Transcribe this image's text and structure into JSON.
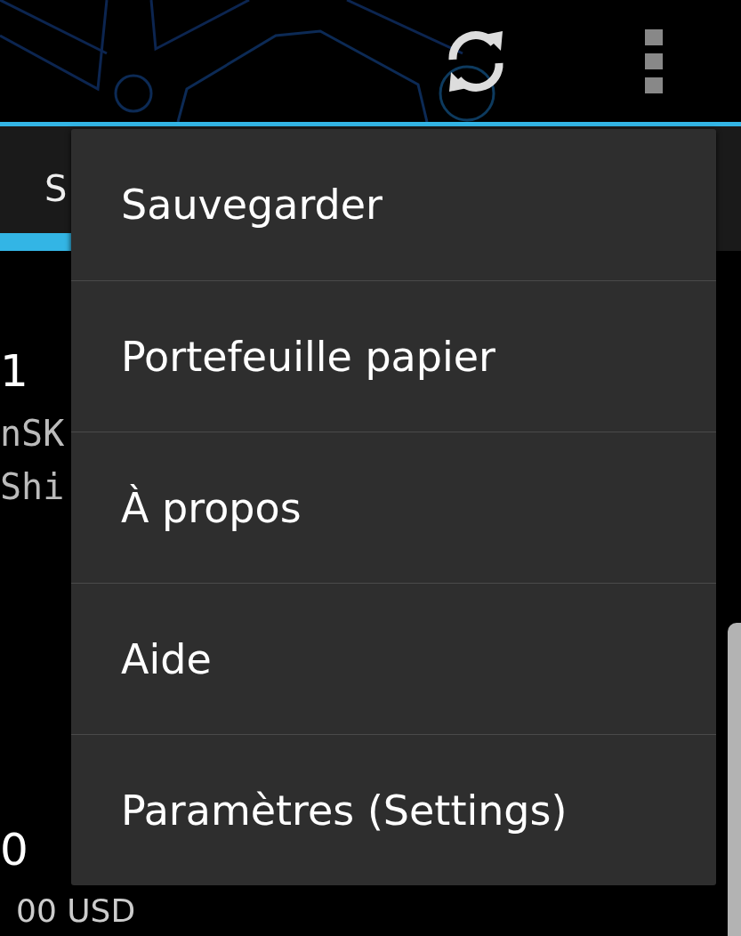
{
  "tab": {
    "label": "S",
    "selected": true
  },
  "content": [
    {
      "kind": "big",
      "text": "1"
    },
    {
      "kind": "mono",
      "text": "nSK"
    },
    {
      "kind": "mono",
      "text": "Shi"
    },
    {
      "kind": "big",
      "text": "0"
    },
    {
      "kind": "amount",
      "text": "00 USD"
    }
  ],
  "menu": {
    "items": [
      "Sauvegarder",
      "Portefeuille papier",
      "À propos",
      "Aide",
      "Paramètres (Settings)"
    ]
  }
}
